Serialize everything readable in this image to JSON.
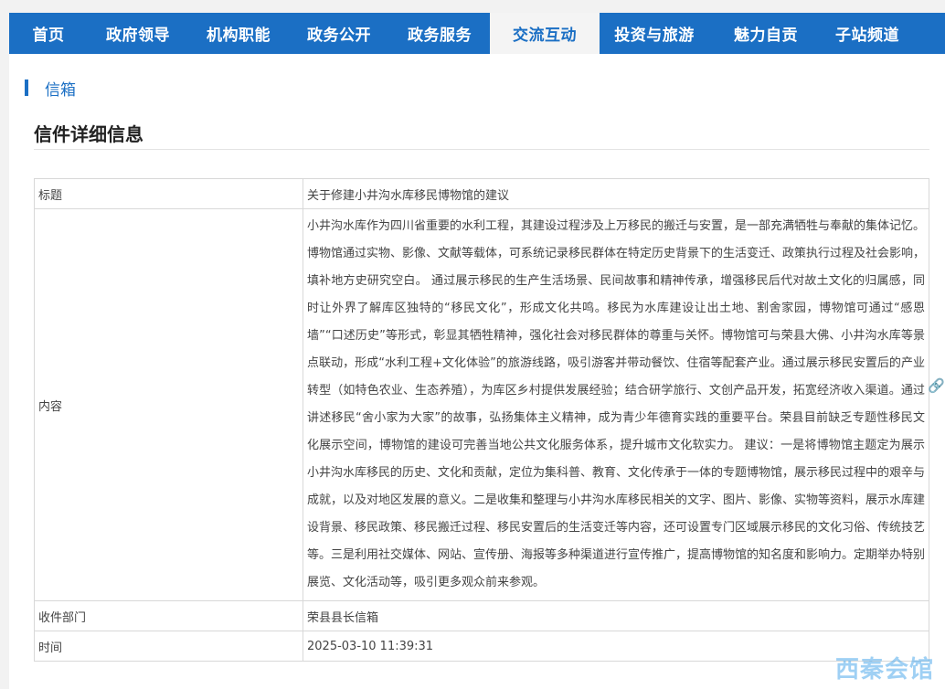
{
  "nav": {
    "items": [
      {
        "label": "首页"
      },
      {
        "label": "政府领导"
      },
      {
        "label": "机构职能"
      },
      {
        "label": "政务公开"
      },
      {
        "label": "政务服务"
      },
      {
        "label": "交流互动",
        "active": true
      },
      {
        "label": "投资与旅游"
      },
      {
        "label": "魅力自贡"
      },
      {
        "label": "子站频道"
      }
    ]
  },
  "breadcrumb": {
    "label": "信箱"
  },
  "page": {
    "title": "信件详细信息"
  },
  "detail": {
    "title_label": "标题",
    "title_value": "关于修建小井沟水库移民博物馆的建议",
    "content_label": "内容",
    "content_value": "小井沟水库作为四川省重要的水利工程，其建设过程涉及上万移民的搬迁与安置，是一部充满牺牲与奉献的集体记忆。博物馆通过实物、影像、文献等载体，可系统记录移民群体在特定历史背景下的生活变迁、政策执行过程及社会影响，填补地方史研究空白。 通过展示移民的生产生活场景、民间故事和精神传承，增强移民后代对故土文化的归属感，同时让外界了解库区独特的“移民文化”，形成文化共鸣。移民为水库建设让出土地、割舍家园，博物馆可通过“感恩墙”“口述历史”等形式，彰显其牺牲精神，强化社会对移民群体的尊重与关怀。博物馆可与荣县大佛、小井沟水库等景点联动，形成“水利工程+文化体验”的旅游线路，吸引游客并带动餐饮、住宿等配套产业。通过展示移民安置后的产业转型（如特色农业、生态养殖），为库区乡村提供发展经验；结合研学旅行、文创产品开发，拓宽经济收入渠道。通过讲述移民“舍小家为大家”的故事，弘扬集体主义精神，成为青少年德育实践的重要平台。荣县目前缺乏专题性移民文化展示空间，博物馆的建设可完善当地公共文化服务体系，提升城市文化软实力。 建议：一是将博物馆主题定为展示小井沟水库移民的历史、文化和贡献，定位为集科普、教育、文化传承于一体的专题博物馆，展示移民过程中的艰辛与成就，以及对地区发展的意义。二是收集和整理与小井沟水库移民相关的文字、图片、影像、实物等资料，展示水库建设背景、移民政策、移民搬迁过程、移民安置后的生活变迁等内容，还可设置专门区域展示移民的文化习俗、传统技艺等。三是利用社交媒体、网站、宣传册、海报等多种渠道进行宣传推广，提高博物馆的知名度和影响力。定期举办特别展览、文化活动等，吸引更多观众前来参观。",
    "dept_label": "收件部门",
    "dept_value": "荣县县长信箱",
    "time_label": "时间",
    "time_value": "2025-03-10 11:39:31"
  },
  "watermark": {
    "text": "西秦会馆"
  },
  "icons": {
    "side": "link-icon"
  },
  "colors": {
    "nav_bg": "#1b6fc4",
    "accent": "#1b6fc4"
  }
}
